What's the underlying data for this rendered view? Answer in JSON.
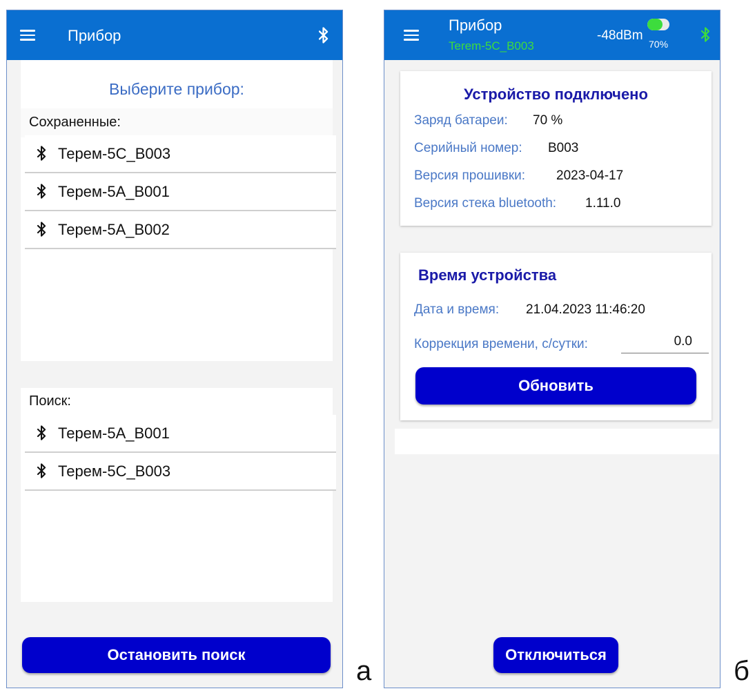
{
  "screen_a": {
    "appbar": {
      "title": "Прибор"
    },
    "prompt": "Выберите прибор:",
    "saved": {
      "label": "Сохраненные:",
      "devices": [
        "Терем-5С_В003",
        "Терем-5А_В001",
        "Терем-5А_В002"
      ]
    },
    "search": {
      "label": "Поиск:",
      "devices": [
        "Терем-5А_В001",
        "Терем-5С_В003"
      ]
    },
    "stop_search_label": "Остановить поиск",
    "caption": "а"
  },
  "screen_b": {
    "appbar": {
      "title": "Прибор",
      "device_name": "Terem-5C_B003",
      "signal": "-48dBm",
      "battery_percent": "70%",
      "battery_level": 0.7
    },
    "device_card": {
      "heading": "Устройство подключено",
      "rows": [
        {
          "label": "Заряд батареи:",
          "value": "70 %"
        },
        {
          "label": "Серийный номер:",
          "value": "B003"
        },
        {
          "label": "Версия прошивки:",
          "value": "2023-04-17"
        },
        {
          "label": "Версия стека bluetooth:",
          "value": "1.11.0"
        }
      ]
    },
    "time_card": {
      "heading": "Время устройства",
      "datetime_label": "Дата и время:",
      "datetime_value": "21.04.2023 11:46:20",
      "correction_label": "Коррекция времени, с/сутки:",
      "correction_value": "0.0",
      "refresh_label": "Обновить"
    },
    "disconnect_label": "Отключиться",
    "caption": "б"
  },
  "colors": {
    "appbar": "#0a6fd1",
    "button": "#0000cc",
    "heading": "#1a1aa8",
    "label": "#4a78c6",
    "device_name": "#3ddc3d",
    "bluetooth_connected": "#3ddc3d"
  },
  "icons": {
    "menu": "hamburger-menu-icon",
    "bluetooth": "bluetooth-icon",
    "battery": "battery-icon"
  }
}
